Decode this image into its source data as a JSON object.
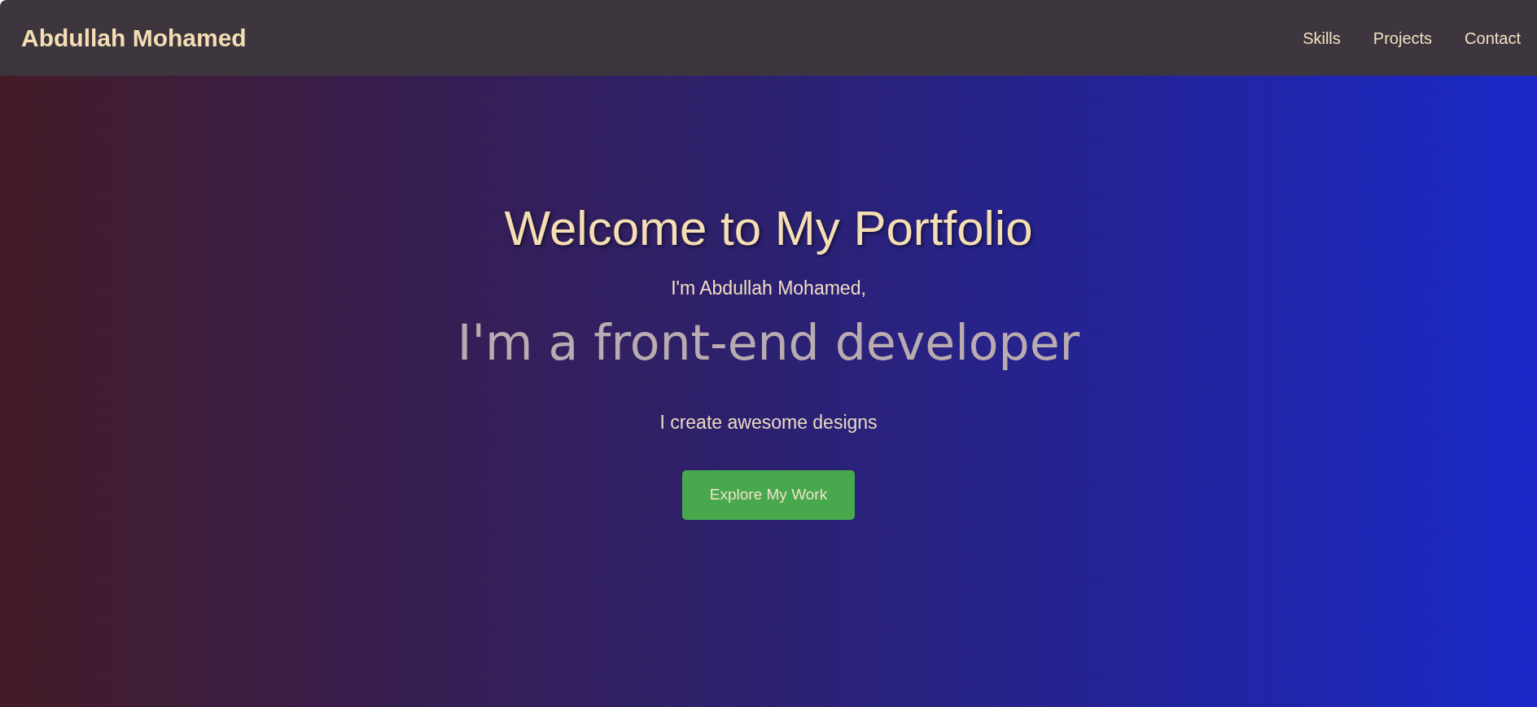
{
  "header": {
    "brand": "Abdullah Mohamed",
    "nav": [
      "Skills",
      "Projects",
      "Contact"
    ]
  },
  "hero": {
    "title": "Welcome to My Portfolio",
    "intro": "I'm Abdullah Mohamed,",
    "role": "I'm a front-end developer",
    "tagline": "I create awesome designs",
    "button": "Explore My Work"
  }
}
